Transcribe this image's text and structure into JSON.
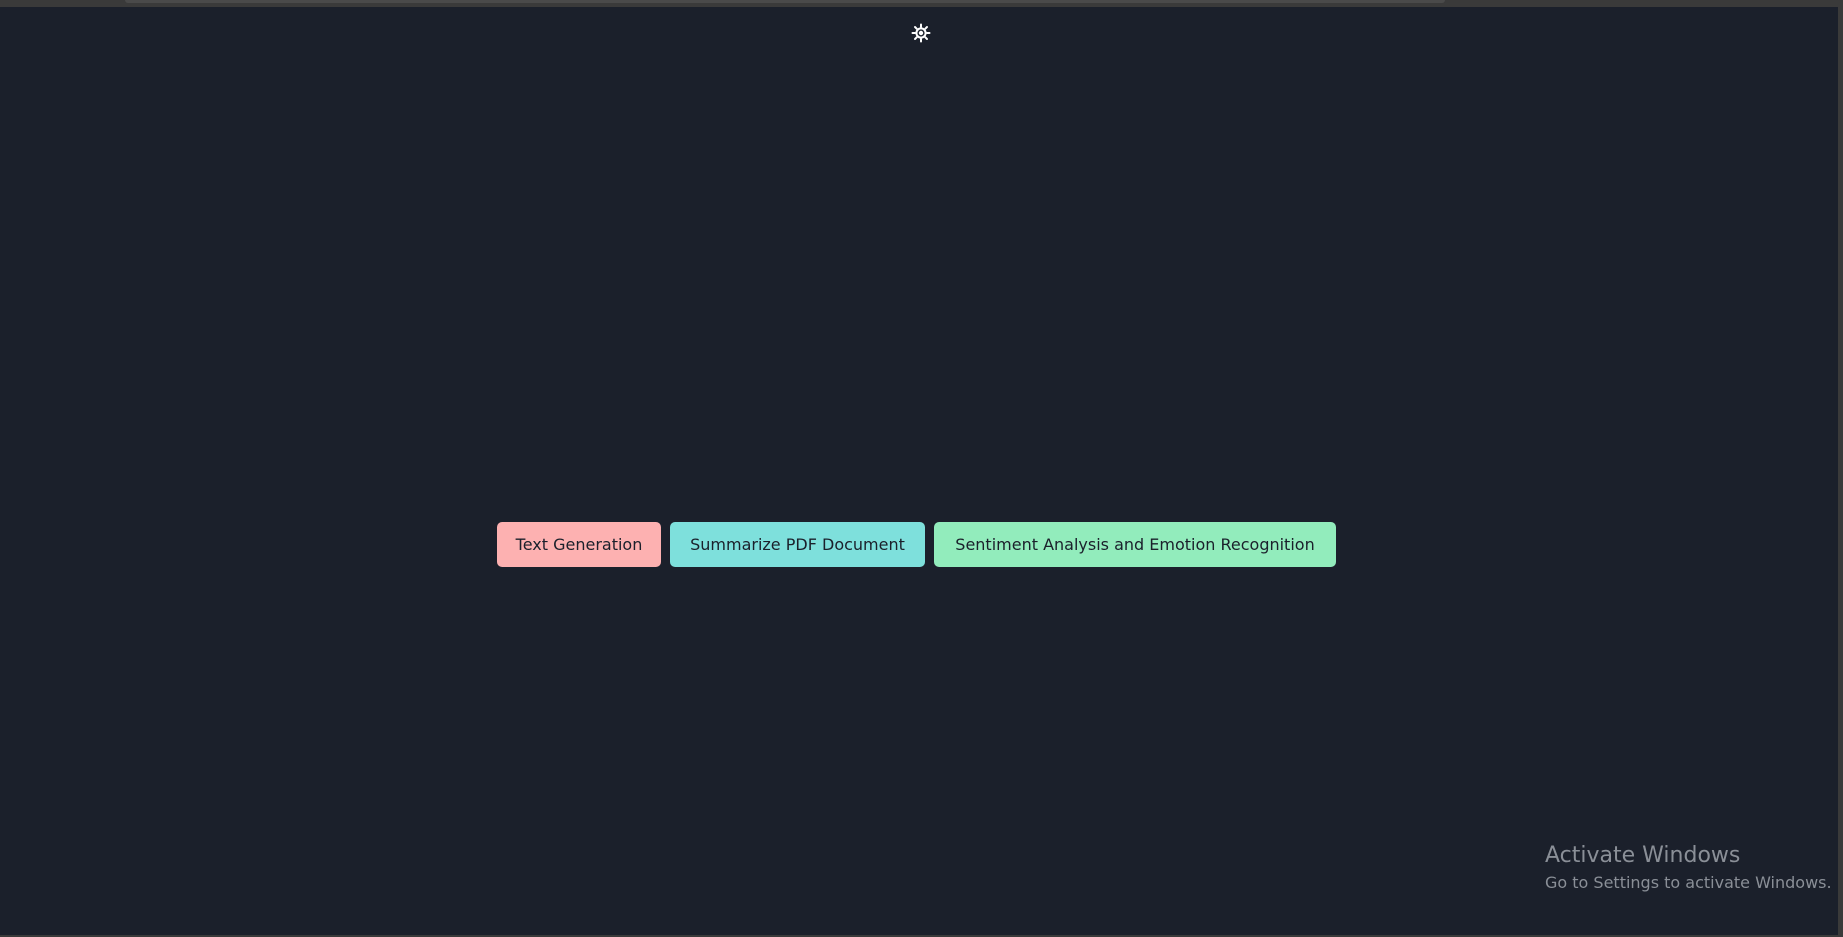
{
  "theme_toggle": {
    "icon": "sun-icon",
    "color": "#ffffff"
  },
  "actions": [
    {
      "label": "Text Generation",
      "color": "#fdb1b1"
    },
    {
      "label": "Summarize PDF Document",
      "color": "#7ee0dc"
    },
    {
      "label": "Sentiment Analysis and Emotion Recognition",
      "color": "#92ecbc"
    }
  ],
  "watermark": {
    "title": "Activate Windows",
    "subtitle": "Go to Settings to activate Windows."
  },
  "colors": {
    "background": "#1b202b",
    "button_text": "#1b202b",
    "watermark_text": "#8a8f97"
  }
}
